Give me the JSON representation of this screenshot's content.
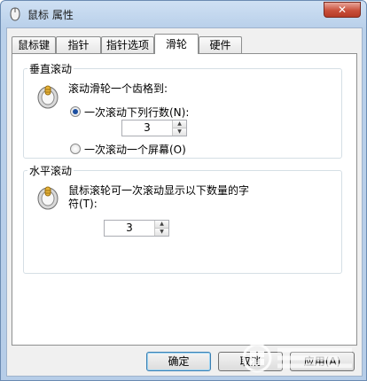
{
  "window": {
    "title": "鼠标 属性",
    "close_glyph": "✕"
  },
  "tabs": [
    "鼠标键",
    "指针",
    "指针选项",
    "滑轮",
    "硬件"
  ],
  "active_tab": "滑轮",
  "vertical": {
    "title": "垂直滚动",
    "prompt": "滚动滑轮一个齿格到:",
    "option_lines": "一次滚动下列行数(N):",
    "lines_value": "3",
    "option_screen": "一次滚动一个屏幕(O)",
    "selected": "lines"
  },
  "horizontal": {
    "title": "水平滚动",
    "prompt_line1": "鼠标滚轮可一次滚动显示以下数量的字",
    "prompt_line2": "符(T):",
    "chars_value": "3"
  },
  "buttons": {
    "ok": "确定",
    "cancel": "取消",
    "apply": "应用(A)"
  },
  "icons": {
    "title": "mouse-icon",
    "wheel": "mouse-wheel-icon",
    "watermark": "system-logo-icon"
  },
  "colors": {
    "titlebar": "#b9d0ea",
    "close": "#c9503b",
    "radio_dot": "#1c4fa0"
  }
}
